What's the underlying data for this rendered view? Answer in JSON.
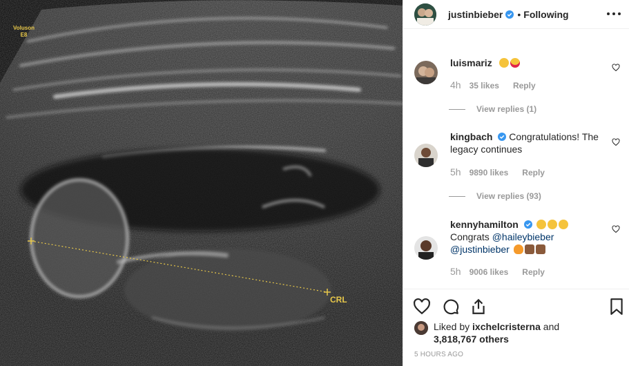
{
  "photo": {
    "device_label_line1": "Voluson",
    "device_label_line2": "E8",
    "measure_label": "CRL"
  },
  "post": {
    "author": "justinbieber",
    "separator": "•",
    "follow_status": "Following"
  },
  "comments": [
    {
      "user": "luismariz",
      "text": "",
      "emojis": [
        "weary-face",
        "heart-eyes"
      ],
      "time": "4h",
      "likes": "35 likes",
      "reply": "Reply",
      "view_replies": "View replies (1)"
    },
    {
      "user": "kingbach",
      "text": "Congratulations! The legacy continues",
      "time": "5h",
      "likes": "9890 likes",
      "reply": "Reply",
      "view_replies": "View replies (93)"
    },
    {
      "user": "kennyhamilton",
      "text_prefix": "Congrats",
      "mention1": "@haileybieber",
      "mention2": "@justinbieber",
      "emojis": [
        "joy",
        "joy",
        "joy",
        "fire",
        "raised-hands",
        "raised-hands"
      ],
      "time": "5h",
      "likes": "9006 likes",
      "reply": "Reply"
    }
  ],
  "likes_summary": {
    "prefix": "Liked by",
    "user": "ixchelcristerna",
    "connector": "and",
    "count": "3,818,767 others"
  },
  "timestamp": "5 HOURS AGO",
  "colors": {
    "verified": "#3897f0",
    "mention": "#003569",
    "muted": "#999999",
    "text": "#262626"
  },
  "icons": [
    "heart-icon",
    "comment-icon",
    "share-icon",
    "bookmark-icon",
    "more-options-icon",
    "verified-badge-icon"
  ]
}
